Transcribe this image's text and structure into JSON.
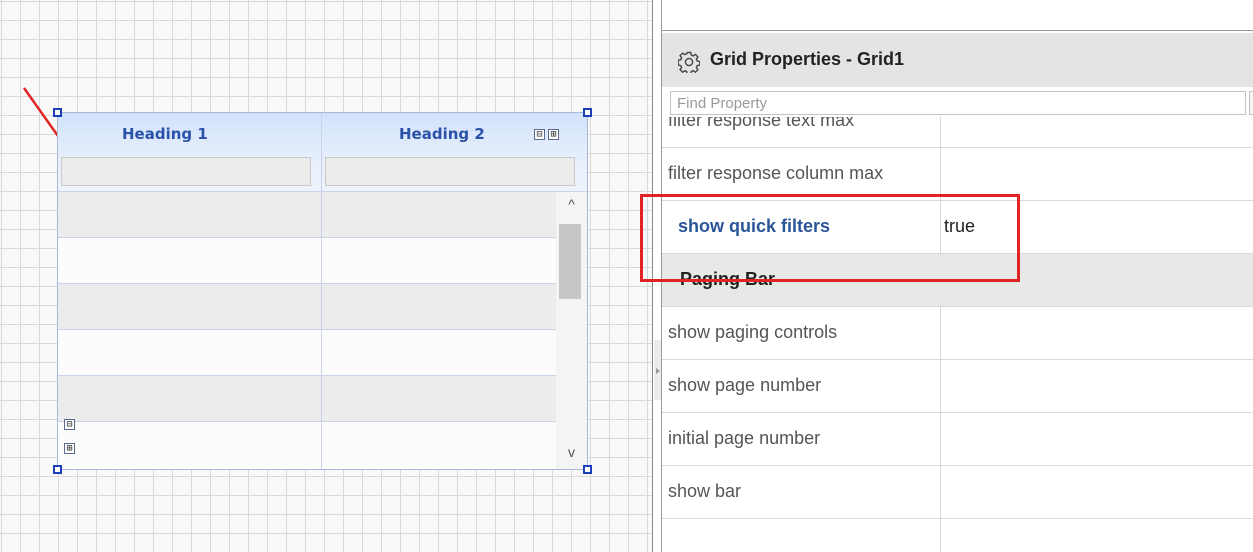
{
  "designer": {
    "grid": {
      "headings": [
        "Heading 1",
        "Heading 2"
      ],
      "collapse_symbol": "⊟",
      "expand_symbol": "⊞",
      "scroll_up_symbol": "^",
      "scroll_down_symbol": "v"
    }
  },
  "panel": {
    "title": "Grid Properties - Grid1",
    "find_placeholder": "Find Property",
    "properties": [
      {
        "name": "filter response text max",
        "value": ""
      },
      {
        "name": "filter response column max",
        "value": ""
      },
      {
        "name": "show quick filters",
        "value": "true",
        "highlight": true
      },
      {
        "name": "Paging Bar",
        "value": "",
        "section": true
      },
      {
        "name": "show paging controls",
        "value": ""
      },
      {
        "name": "show page number",
        "value": ""
      },
      {
        "name": "initial page number",
        "value": ""
      },
      {
        "name": "show bar",
        "value": ""
      }
    ]
  },
  "colors": {
    "highlight_box": "#e02424",
    "selection_handle": "#1a3fb8",
    "heading_text": "#2a52a8",
    "highlighted_property": "#2a5699"
  }
}
